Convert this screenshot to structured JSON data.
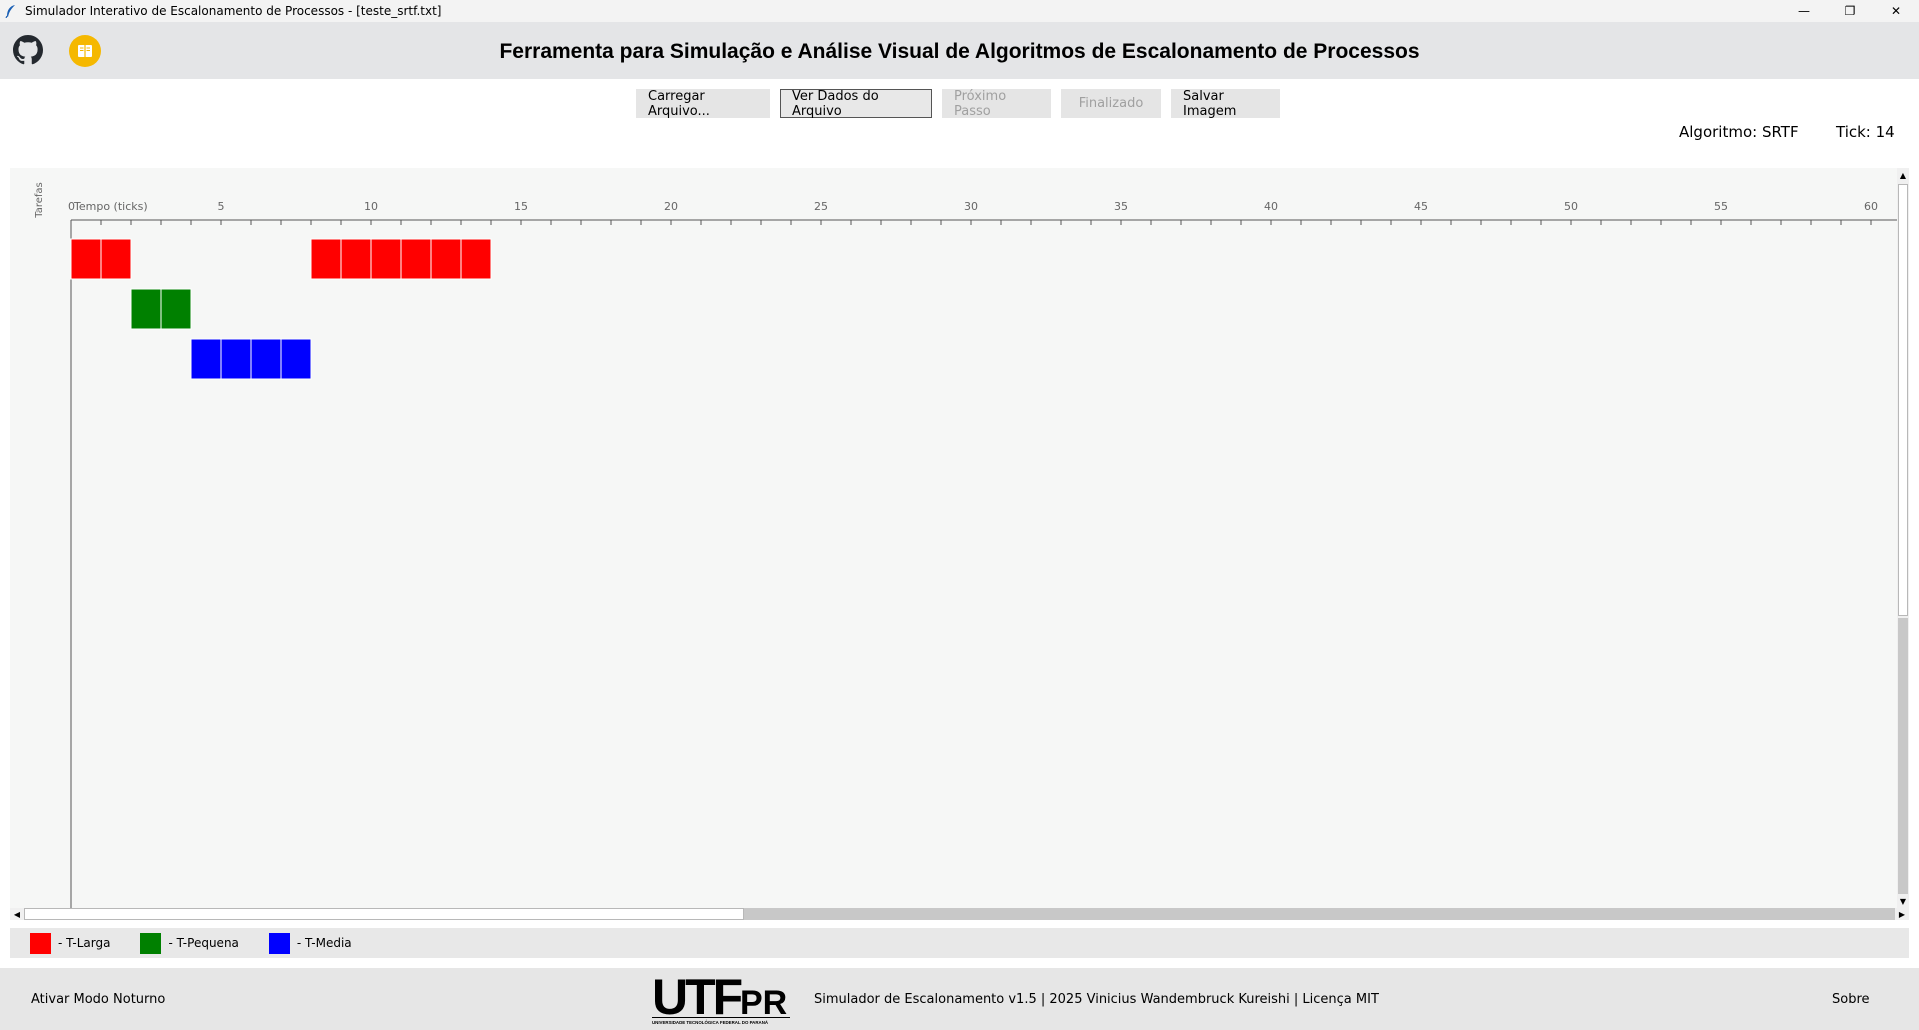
{
  "window": {
    "title": "Simulador Interativo de Escalonamento de Processos - [teste_srtf.txt]",
    "minimize_glyph": "—",
    "maximize_glyph": "❐",
    "close_glyph": "✕"
  },
  "header": {
    "title": "Ferramenta para Simulação e Análise Visual de Algoritmos de Escalonamento de Processos",
    "icons": [
      "github-icon",
      "book-icon"
    ],
    "book_icon_color": "#f5b800"
  },
  "toolbar": {
    "buttons": [
      {
        "label": "Carregar Arquivo...",
        "state": "enabled"
      },
      {
        "label": "Ver Dados do Arquivo",
        "state": "focused"
      },
      {
        "label": "Próximo Passo",
        "state": "disabled"
      },
      {
        "label": "Finalizado",
        "state": "disabled"
      },
      {
        "label": "Salvar Imagem",
        "state": "enabled"
      }
    ]
  },
  "status": {
    "algorithm": "Algoritmo: SRTF",
    "tick": "Tick: 14"
  },
  "chart_data": {
    "type": "gantt",
    "xlabel": "Tempo (ticks)",
    "ylabel": "Tarefas",
    "xlim": [
      0,
      60
    ],
    "major_ticks": [
      0,
      5,
      10,
      15,
      20,
      25,
      30,
      35,
      40,
      45,
      50,
      55,
      60
    ],
    "minor_tick_step": 1,
    "tasks": [
      {
        "name": "T-Larga",
        "color": "#ff0000",
        "executed_ticks": [
          0,
          1,
          8,
          9,
          10,
          11,
          12,
          13
        ]
      },
      {
        "name": "T-Pequena",
        "color": "#008000",
        "executed_ticks": [
          2,
          3
        ]
      },
      {
        "name": "T-Media",
        "color": "#0000ff",
        "executed_ticks": [
          4,
          5,
          6,
          7
        ]
      }
    ]
  },
  "legend": [
    {
      "label": "- T-Larga",
      "color": "#ff0000"
    },
    {
      "label": "- T-Pequena",
      "color": "#008000"
    },
    {
      "label": "- T-Media",
      "color": "#0000ff"
    }
  ],
  "footer": {
    "night_mode": "Ativar Modo Noturno",
    "logo_text": "UTFPR",
    "logo_subtitle": "UNIVERSIDADE TECNOLÓGICA FEDERAL DO PARANÁ",
    "credits": "Simulador de Escalonamento v1.5 | 2025 Vinicius Wandembruck Kureishi | Licença MIT",
    "about": "Sobre"
  }
}
